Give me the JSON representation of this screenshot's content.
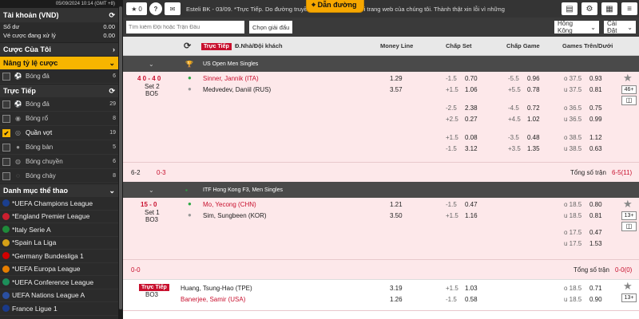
{
  "sidebar": {
    "datetime": "05/09/2024 10:14 (GMT +8)",
    "account_title": "Tài khoản (VND)",
    "balance_label": "Số dư",
    "balance_value": "0.00",
    "pending_label": "Vé cược đang xử lý",
    "pending_value": "0.00",
    "my_bets": "Cược Của Tôi",
    "boost": "Nâng tỷ lệ cược",
    "boost_items": [
      {
        "label": "Bóng đá",
        "count": "6"
      }
    ],
    "live_title": "Trực Tiếp",
    "live_items": [
      {
        "label": "Bóng đá",
        "count": "29"
      },
      {
        "label": "Bóng rổ",
        "count": "8"
      },
      {
        "label": "Quần vợt",
        "count": "19"
      },
      {
        "label": "Bóng bàn",
        "count": "5"
      },
      {
        "label": "Bóng chuyền",
        "count": "6"
      },
      {
        "label": "Bóng chày",
        "count": "8"
      }
    ],
    "categories_title": "Danh mục thể thao",
    "leagues": [
      {
        "label": "*UEFA Champions League",
        "color": "#1b3f8f"
      },
      {
        "label": "*England Premier League",
        "color": "#cc1f2f"
      },
      {
        "label": "*Italy Serie A",
        "color": "#1f8b3a"
      },
      {
        "label": "*Spain La Liga",
        "color": "#d4a017"
      },
      {
        "label": "*Germany Bundesliga 1",
        "color": "#d10000"
      },
      {
        "label": "*UEFA Europa League",
        "color": "#e67e00"
      },
      {
        "label": "*UEFA Conference League",
        "color": "#1d8f5a"
      },
      {
        "label": "UEFA Nations League A",
        "color": "#2a4fa0"
      },
      {
        "label": "France Ligue 1",
        "color": "#1a3a8a"
      }
    ]
  },
  "topbar": {
    "star_count": "0",
    "marquee": "Esteli BK - 03/09. *Trực Tiếp. Do đường truyền ... sẽ được xóa khỏi trang web của chúng tôi. Thành thật xin lỗi vì những",
    "dan_duong": "Dẫn đường"
  },
  "search": {
    "placeholder": "Tìm kiếm Đội hoặc Trận Đấu",
    "choose_league": "Chọn giải đấu",
    "odds_type": "Hồng Kông",
    "settings": "Cài Đặt"
  },
  "columns": {
    "live_badge": "Trực Tiếp",
    "home_away": "Đ.Nhà/Đội khách",
    "money_line": "Money Line",
    "set_handicap": "Chấp Set",
    "game_handicap": "Chấp Game",
    "total_games": "Games Trên/Dưới"
  },
  "matches": [
    {
      "league": "US Open Men Singles",
      "score": "4 0 - 4 0",
      "set": "Set 2",
      "bo": "BO5",
      "home": "Sinner, Jannik (ITA)",
      "away": "Medvedev, Daniil (RUS)",
      "ml": [
        "1.29",
        "3.57"
      ],
      "lines": [
        {
          "set_h": [
            "-1.5",
            "+1.5"
          ],
          "set_o": [
            "0.70",
            "1.06"
          ],
          "game_h": [
            "-5.5",
            "+5.5"
          ],
          "game_o": [
            "0.96",
            "0.78"
          ],
          "tot_h": [
            "o 37.5",
            "u 37.5"
          ],
          "tot_o": [
            "0.93",
            "0.81"
          ]
        },
        {
          "set_h": [
            "-2.5",
            "+2.5"
          ],
          "set_o": [
            "2.38",
            "0.27"
          ],
          "game_h": [
            "-4.5",
            "+4.5"
          ],
          "game_o": [
            "0.72",
            "1.02"
          ],
          "tot_h": [
            "o 36.5",
            "u 36.5"
          ],
          "tot_o": [
            "0.75",
            "0.99"
          ]
        },
        {
          "set_h": [
            "+1.5",
            "-1.5"
          ],
          "set_o": [
            "0.08",
            "3.12"
          ],
          "game_h": [
            "-3.5",
            "+3.5"
          ],
          "game_o": [
            "0.48",
            "1.35"
          ],
          "tot_h": [
            "o 38.5",
            "u 38.5"
          ],
          "tot_o": [
            "1.12",
            "0.63"
          ]
        }
      ],
      "more": "46+",
      "set_score_a": "6-2",
      "set_score_b": "0-3",
      "total_label": "Tổng số trận",
      "total_val": "6-5(11)"
    },
    {
      "league": "ITF Hong Kong F3, Men Singles",
      "score": "15 - 0",
      "set": "Set 1",
      "bo": "BO3",
      "home": "Mo, Yecong (CHN)",
      "away": "Sim, Sungbeen (KOR)",
      "ml": [
        "1.21",
        "3.50"
      ],
      "lines": [
        {
          "set_h": [
            "-1.5",
            "+1.5"
          ],
          "set_o": [
            "0.47",
            "1.16"
          ],
          "tot_h": [
            "o 18.5",
            "u 18.5"
          ],
          "tot_o": [
            "0.80",
            "0.81"
          ]
        },
        {
          "tot_h": [
            "o 17.5",
            "u 17.5"
          ],
          "tot_o": [
            "0.47",
            "1.53"
          ]
        }
      ],
      "more": "13+",
      "set_score_a": "0-0",
      "total_label": "Tổng số trận",
      "total_val": "0-0(0)"
    },
    {
      "live_badge": "Trực Tiếp",
      "bo": "BO3",
      "home": "Huang, Tsung-Hao (TPE)",
      "away": "Banerjee, Samir (USA)",
      "ml": [
        "3.19",
        "1.26"
      ],
      "lines": [
        {
          "set_h": [
            "+1.5",
            "-1.5"
          ],
          "set_o": [
            "1.03",
            "0.58"
          ],
          "tot_h": [
            "o 18.5",
            "u 18.5"
          ],
          "tot_o": [
            "0.71",
            "0.90"
          ]
        }
      ],
      "more": "13+"
    }
  ]
}
